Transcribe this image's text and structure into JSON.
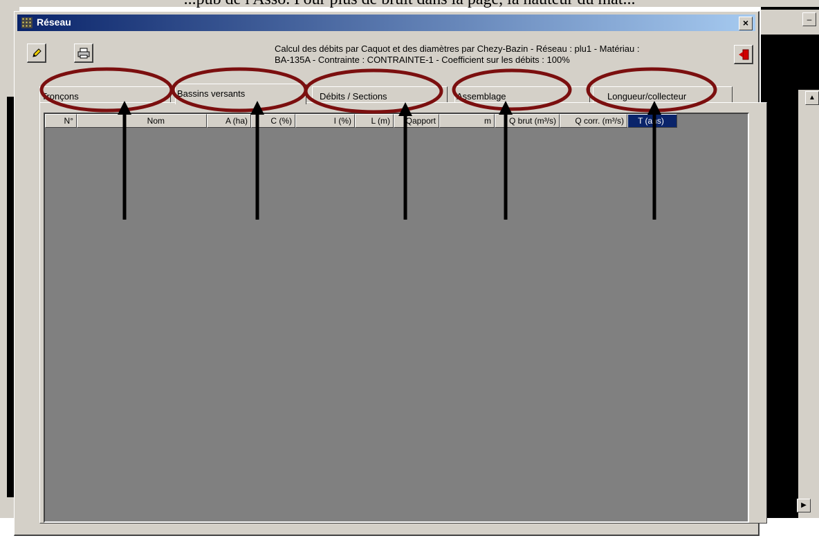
{
  "caption": "...pub de l'Asso.  Pour plus de bruit dans la page, la hauteur du mat...",
  "window": {
    "title": "Réseau",
    "close_label": "×"
  },
  "toolbar": {
    "edit_icon": "pencil-icon",
    "print_icon": "printer-icon",
    "exit_icon": "exit-door-icon"
  },
  "info": {
    "line1": "Calcul des débits par Caquot et des diamètres par Chezy-Bazin - Réseau : plu1 - Matériau :",
    "line2": "BA-135A - Contrainte : CONTRAINTE-1 - Coefficient sur les débits : 100%"
  },
  "tabs": [
    {
      "label": "Tronçons"
    },
    {
      "label": "Bassins versants"
    },
    {
      "label": "Débits / Sections"
    },
    {
      "label": "Assemblage"
    },
    {
      "label": "Longueur/collecteur"
    }
  ],
  "grid": {
    "columns": [
      "N°",
      "Nom",
      "A (ha)",
      "C (%)",
      "I (%)",
      "L (m)",
      "Qapport",
      "m",
      "Q brut (m³/s)",
      "Q corr. (m³/s)",
      "T (ans)"
    ]
  },
  "annotations": {
    "ellipse_color": "#7b0f0f",
    "arrow_color": "#000000"
  }
}
